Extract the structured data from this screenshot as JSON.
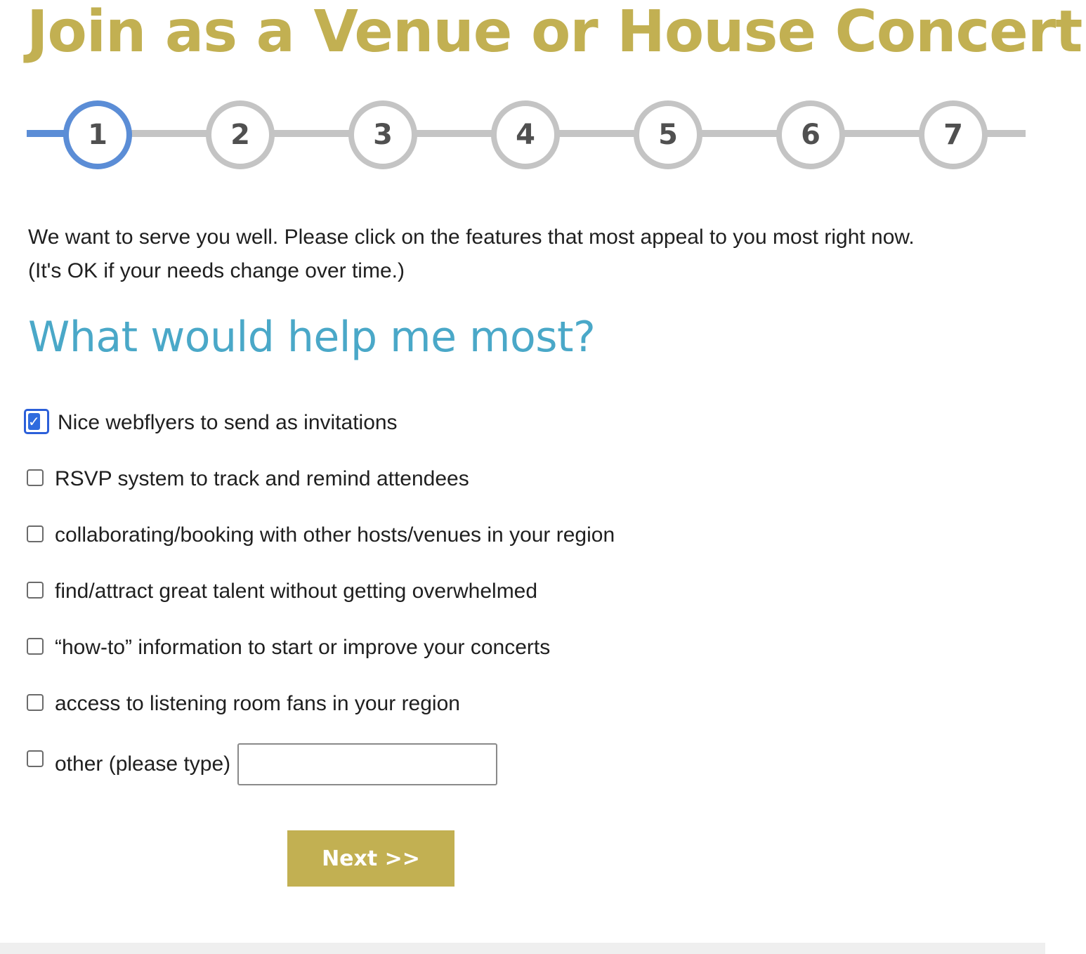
{
  "colors": {
    "title_gold": "#c2b052",
    "heading_blue": "#4aa8c8",
    "active_step_blue": "#5b8dd6",
    "inactive_step_gray": "#c4c4c4",
    "button_gold": "#c2b052"
  },
  "header": {
    "title": "Join as a Venue or House Concert"
  },
  "stepper": {
    "current_step": 1,
    "steps": [
      "1",
      "2",
      "3",
      "4",
      "5",
      "6",
      "7"
    ]
  },
  "intro": {
    "line1": "We want to serve you well. Please click on the features that most appeal to you most right now.",
    "line2": "(It's OK if your needs change over time.)"
  },
  "question": {
    "heading": "What would help me most?"
  },
  "options": [
    {
      "label": "Nice webflyers to send as invitations",
      "checked": true
    },
    {
      "label": "RSVP system to track and remind attendees",
      "checked": false
    },
    {
      "label": "collaborating/booking with other hosts/venues in your region",
      "checked": false
    },
    {
      "label": "find/attract great talent without getting overwhelmed",
      "checked": false
    },
    {
      "label": "“how-to” information to start or improve your concerts",
      "checked": false
    },
    {
      "label": "access to listening room fans in your region",
      "checked": false
    },
    {
      "label": "other (please type)",
      "checked": false,
      "input_value": ""
    }
  ],
  "actions": {
    "next_label": "Next >>"
  },
  "icons": {
    "checkmark": "checkmark-icon"
  }
}
